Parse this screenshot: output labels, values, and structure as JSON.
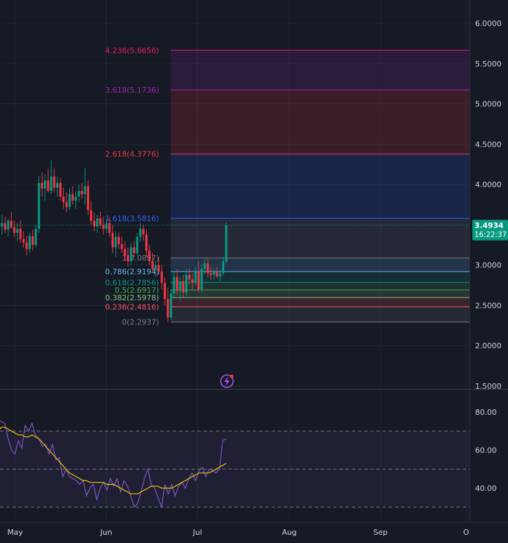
{
  "chart_data": {
    "type": "candlestick",
    "price_axis": {
      "ticks": [
        "6.0000",
        "5.5000",
        "5.0000",
        "4.5000",
        "4.0000",
        "3.5000",
        "3.0000",
        "2.5000",
        "2.0000",
        "1.5000"
      ],
      "tick_values": [
        6.0,
        5.5,
        5.0,
        4.5,
        4.0,
        3.5,
        3.0,
        2.5,
        2.0,
        1.5
      ],
      "ylim": [
        1.45,
        6.15
      ]
    },
    "time_axis": {
      "labels": [
        "May",
        "Jun",
        "Jul",
        "Aug",
        "Sep",
        "O"
      ]
    },
    "current_price": {
      "value": "3.4934",
      "countdown": "16:22:37",
      "color": "#089981"
    },
    "fibonacci": {
      "levels": [
        {
          "label": "4.236(5.6656)",
          "ratio": 4.236,
          "price": 5.6656,
          "color": "#e91e63"
        },
        {
          "label": "3.618(5.1736)",
          "ratio": 3.618,
          "price": 5.1736,
          "color": "#9c27b0"
        },
        {
          "label": "2.618(4.3776)",
          "ratio": 2.618,
          "price": 4.3776,
          "color": "#f23645"
        },
        {
          "label": "1.618(3.5816)",
          "ratio": 1.618,
          "price": 3.5816,
          "color": "#2962ff"
        },
        {
          "label": "1(3.0897)",
          "ratio": 1,
          "price": 3.0897,
          "color": "#787b86"
        },
        {
          "label": "0.786(2.9194)",
          "ratio": 0.786,
          "price": 2.9194,
          "color": "#64b5f6"
        },
        {
          "label": "0.618(2.7856)",
          "ratio": 0.618,
          "price": 2.7856,
          "color": "#089981"
        },
        {
          "label": "0.5(2.6917)",
          "ratio": 0.5,
          "price": 2.6917,
          "color": "#4caf50"
        },
        {
          "label": "0.382(2.5978)",
          "ratio": 0.382,
          "price": 2.5978,
          "color": "#81c784"
        },
        {
          "label": "0.236(2.4816)",
          "ratio": 0.236,
          "price": 2.4816,
          "color": "#f7525f"
        },
        {
          "label": "0(2.2937)",
          "ratio": 0,
          "price": 2.2937,
          "color": "#787b86"
        }
      ]
    },
    "candles": [
      {
        "o": 3.48,
        "h": 3.62,
        "l": 3.38,
        "c": 3.52
      },
      {
        "o": 3.52,
        "h": 3.6,
        "l": 3.4,
        "c": 3.44
      },
      {
        "o": 3.44,
        "h": 3.58,
        "l": 3.36,
        "c": 3.55
      },
      {
        "o": 3.55,
        "h": 3.66,
        "l": 3.45,
        "c": 3.47
      },
      {
        "o": 3.47,
        "h": 3.55,
        "l": 3.35,
        "c": 3.4
      },
      {
        "o": 3.4,
        "h": 3.52,
        "l": 3.3,
        "c": 3.45
      },
      {
        "o": 3.45,
        "h": 3.56,
        "l": 3.28,
        "c": 3.32
      },
      {
        "o": 3.32,
        "h": 3.42,
        "l": 3.22,
        "c": 3.28
      },
      {
        "o": 3.28,
        "h": 3.36,
        "l": 3.12,
        "c": 3.2
      },
      {
        "o": 3.2,
        "h": 3.4,
        "l": 3.15,
        "c": 3.36
      },
      {
        "o": 3.36,
        "h": 3.44,
        "l": 3.18,
        "c": 3.25
      },
      {
        "o": 3.25,
        "h": 3.5,
        "l": 3.22,
        "c": 3.45
      },
      {
        "o": 3.45,
        "h": 4.1,
        "l": 3.4,
        "c": 4.02
      },
      {
        "o": 4.02,
        "h": 4.15,
        "l": 3.85,
        "c": 3.95
      },
      {
        "o": 3.95,
        "h": 4.12,
        "l": 3.8,
        "c": 4.05
      },
      {
        "o": 4.05,
        "h": 4.2,
        "l": 3.9,
        "c": 3.92
      },
      {
        "o": 3.92,
        "h": 4.3,
        "l": 3.88,
        "c": 4.1
      },
      {
        "o": 4.1,
        "h": 4.2,
        "l": 3.9,
        "c": 3.96
      },
      {
        "o": 3.96,
        "h": 4.1,
        "l": 3.85,
        "c": 4.02
      },
      {
        "o": 4.02,
        "h": 4.08,
        "l": 3.8,
        "c": 3.85
      },
      {
        "o": 3.85,
        "h": 3.96,
        "l": 3.7,
        "c": 3.78
      },
      {
        "o": 3.78,
        "h": 3.9,
        "l": 3.65,
        "c": 3.72
      },
      {
        "o": 3.72,
        "h": 3.95,
        "l": 3.68,
        "c": 3.88
      },
      {
        "o": 3.88,
        "h": 3.98,
        "l": 3.75,
        "c": 3.8
      },
      {
        "o": 3.8,
        "h": 3.92,
        "l": 3.7,
        "c": 3.85
      },
      {
        "o": 3.85,
        "h": 4.0,
        "l": 3.78,
        "c": 3.92
      },
      {
        "o": 3.92,
        "h": 4.02,
        "l": 3.82,
        "c": 3.88
      },
      {
        "o": 3.88,
        "h": 4.2,
        "l": 3.75,
        "c": 3.98
      },
      {
        "o": 3.98,
        "h": 4.05,
        "l": 3.62,
        "c": 3.68
      },
      {
        "o": 3.68,
        "h": 3.8,
        "l": 3.5,
        "c": 3.55
      },
      {
        "o": 3.55,
        "h": 3.65,
        "l": 3.42,
        "c": 3.48
      },
      {
        "o": 3.48,
        "h": 3.62,
        "l": 3.4,
        "c": 3.58
      },
      {
        "o": 3.58,
        "h": 3.66,
        "l": 3.45,
        "c": 3.5
      },
      {
        "o": 3.5,
        "h": 3.6,
        "l": 3.38,
        "c": 3.45
      },
      {
        "o": 3.45,
        "h": 3.58,
        "l": 3.4,
        "c": 3.52
      },
      {
        "o": 3.52,
        "h": 3.6,
        "l": 3.35,
        "c": 3.4
      },
      {
        "o": 3.4,
        "h": 3.5,
        "l": 3.15,
        "c": 3.22
      },
      {
        "o": 3.22,
        "h": 3.42,
        "l": 3.1,
        "c": 3.35
      },
      {
        "o": 3.35,
        "h": 3.4,
        "l": 3.2,
        "c": 3.26
      },
      {
        "o": 3.26,
        "h": 3.35,
        "l": 3.15,
        "c": 3.2
      },
      {
        "o": 3.2,
        "h": 3.3,
        "l": 3.05,
        "c": 3.12
      },
      {
        "o": 3.12,
        "h": 3.22,
        "l": 2.98,
        "c": 3.05
      },
      {
        "o": 3.05,
        "h": 3.28,
        "l": 3.0,
        "c": 3.22
      },
      {
        "o": 3.22,
        "h": 3.3,
        "l": 3.1,
        "c": 3.15
      },
      {
        "o": 3.15,
        "h": 3.4,
        "l": 3.12,
        "c": 3.35
      },
      {
        "o": 3.35,
        "h": 3.52,
        "l": 3.28,
        "c": 3.45
      },
      {
        "o": 3.45,
        "h": 3.5,
        "l": 3.3,
        "c": 3.38
      },
      {
        "o": 3.38,
        "h": 3.44,
        "l": 3.1,
        "c": 3.18
      },
      {
        "o": 3.18,
        "h": 3.25,
        "l": 3.0,
        "c": 3.05
      },
      {
        "o": 3.05,
        "h": 3.15,
        "l": 2.9,
        "c": 2.95
      },
      {
        "o": 2.95,
        "h": 3.05,
        "l": 2.85,
        "c": 3.0
      },
      {
        "o": 3.0,
        "h": 3.1,
        "l": 2.88,
        "c": 2.92
      },
      {
        "o": 2.92,
        "h": 3.0,
        "l": 2.7,
        "c": 2.78
      },
      {
        "o": 2.78,
        "h": 2.85,
        "l": 2.5,
        "c": 2.58
      },
      {
        "o": 2.58,
        "h": 2.72,
        "l": 2.29,
        "c": 2.35
      },
      {
        "o": 2.35,
        "h": 2.7,
        "l": 2.32,
        "c": 2.65
      },
      {
        "o": 2.65,
        "h": 2.92,
        "l": 2.6,
        "c": 2.85
      },
      {
        "o": 2.85,
        "h": 2.95,
        "l": 2.62,
        "c": 2.68
      },
      {
        "o": 2.68,
        "h": 2.85,
        "l": 2.55,
        "c": 2.8
      },
      {
        "o": 2.8,
        "h": 2.88,
        "l": 2.6,
        "c": 2.66
      },
      {
        "o": 2.66,
        "h": 2.95,
        "l": 2.62,
        "c": 2.88
      },
      {
        "o": 2.88,
        "h": 2.96,
        "l": 2.75,
        "c": 2.82
      },
      {
        "o": 2.82,
        "h": 2.9,
        "l": 2.7,
        "c": 2.78
      },
      {
        "o": 2.78,
        "h": 2.98,
        "l": 2.74,
        "c": 2.92
      },
      {
        "o": 2.92,
        "h": 3.05,
        "l": 2.66,
        "c": 2.7
      },
      {
        "o": 2.7,
        "h": 3.02,
        "l": 2.66,
        "c": 2.95
      },
      {
        "o": 2.95,
        "h": 3.08,
        "l": 2.88,
        "c": 3.02
      },
      {
        "o": 3.02,
        "h": 3.08,
        "l": 2.85,
        "c": 2.9
      },
      {
        "o": 2.9,
        "h": 2.98,
        "l": 2.82,
        "c": 2.88
      },
      {
        "o": 2.88,
        "h": 2.96,
        "l": 2.82,
        "c": 2.92
      },
      {
        "o": 2.92,
        "h": 2.98,
        "l": 2.84,
        "c": 2.86
      },
      {
        "o": 2.86,
        "h": 2.95,
        "l": 2.8,
        "c": 2.9
      },
      {
        "o": 2.9,
        "h": 3.1,
        "l": 2.88,
        "c": 3.05
      },
      {
        "o": 3.05,
        "h": 3.53,
        "l": 3.02,
        "c": 3.4934
      }
    ],
    "rsi": {
      "axis_ticks": [
        "80.00",
        "60.00",
        "40.00"
      ],
      "tick_values": [
        80,
        60,
        40
      ],
      "ylim": [
        25,
        85
      ],
      "upper": 70,
      "middle": 50,
      "lower": 30,
      "line_color": "#7e57c2",
      "ma_color": "#f7c600",
      "values": [
        77,
        76,
        75,
        74,
        66,
        60,
        58,
        65,
        61,
        73,
        70,
        74,
        68,
        66,
        62,
        63,
        58,
        63,
        55,
        56,
        46,
        50,
        46,
        45,
        44,
        42,
        44,
        36,
        40,
        42,
        34,
        40,
        43,
        39,
        45,
        41,
        45,
        38,
        44,
        41,
        36,
        30,
        32,
        38,
        45,
        50,
        42,
        40,
        35,
        30,
        42,
        37,
        42,
        36,
        41,
        43,
        40,
        45,
        48,
        44,
        49,
        51,
        46,
        50,
        49,
        48,
        50,
        65,
        66
      ],
      "ma": [
        68,
        70,
        72,
        72,
        71,
        70,
        69,
        68,
        68,
        67,
        67,
        68,
        67,
        66,
        64,
        62,
        60,
        58,
        56,
        54,
        52,
        50,
        48,
        47,
        46,
        45,
        44,
        44,
        43,
        43,
        43,
        43,
        43,
        42,
        42,
        42,
        41,
        40,
        39,
        38,
        37,
        37,
        37,
        38,
        39,
        40,
        41,
        41,
        41,
        40,
        40,
        40,
        40,
        41,
        42,
        43,
        44,
        45,
        46,
        47,
        48,
        48,
        48,
        48,
        49,
        50,
        51,
        52,
        53
      ]
    }
  }
}
